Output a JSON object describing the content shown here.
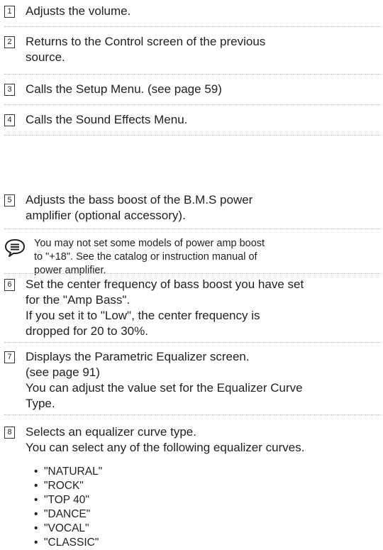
{
  "items": [
    {
      "number": "1",
      "lines": [
        "Adjusts the volume."
      ]
    },
    {
      "number": "2",
      "lines": [
        "Returns to the Control screen of the previous",
        "source."
      ]
    },
    {
      "number": "3",
      "lines": [
        "Calls the Setup Menu. (see page 59)"
      ]
    },
    {
      "number": "4",
      "lines": [
        "Calls the Sound Effects Menu."
      ]
    },
    {
      "number": "5",
      "lines": [
        "Adjusts the bass boost of the B.M.S power",
        "amplifier (optional accessory)."
      ]
    },
    {
      "number": "6",
      "lines": [
        "Set the center frequency of bass boost you have set",
        "for the \"Amp Bass\".",
        "If you set it to \"Low\", the center frequency is",
        "dropped for 20 to 30%."
      ]
    },
    {
      "number": "7",
      "lines": [
        "Displays the Parametric Equalizer screen.",
        "(see page 91)",
        "You can adjust the value set for the Equalizer Curve",
        "Type."
      ]
    },
    {
      "number": "8",
      "lines": [
        "Selects an equalizer curve type.",
        "You can select any of the following equalizer curves."
      ]
    }
  ],
  "note": {
    "icon": "note-icon",
    "lines": [
      "You may not set some models of power amp boost",
      "to \"+18\". See the catalog or instruction manual of",
      "power amplifier."
    ]
  },
  "curve_options": [
    "\"NATURAL\"",
    "\"ROCK\"",
    "\"TOP 40\"",
    "\"DANCE\"",
    "\"VOCAL\"",
    "\"CLASSIC\""
  ],
  "bullet_char": "•"
}
